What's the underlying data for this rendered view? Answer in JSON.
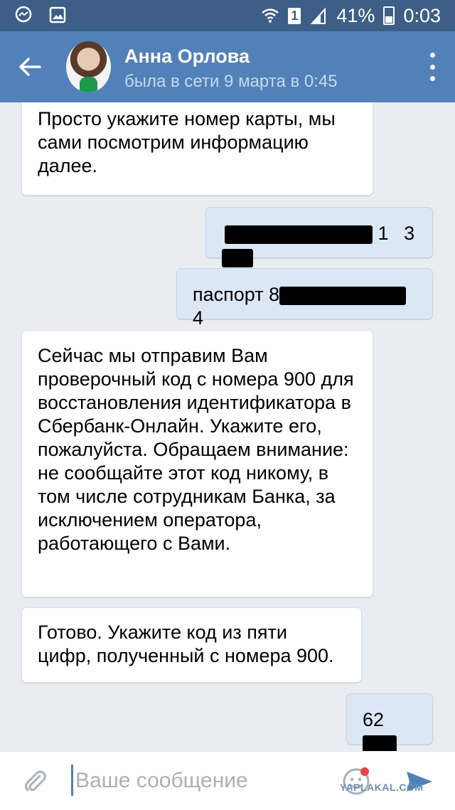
{
  "statusbar": {
    "battery": "41%",
    "time": "0:03",
    "sim": "1"
  },
  "header": {
    "name": "Анна Орлова",
    "status": "была в сети 9 марта в 0:45"
  },
  "messages": [
    {
      "direction": "in",
      "text": "Просто укажите номер карты, мы сами посмотрим информацию далее."
    },
    {
      "direction": "out",
      "prefix": "",
      "visible_parts": [
        "1",
        "3"
      ]
    },
    {
      "direction": "out",
      "prefix": "паспорт 8",
      "suffix": "4"
    },
    {
      "direction": "in",
      "text": "Сейчас мы отправим Вам проверочный код с номера 900 для восстановления идентификатора в Сбербанк-Онлайн. Укажите его, пожалуйста. Обращаем внимание: не сообщайте этот код никому, в том числе сотрудникам Банка, за исключением оператора, работающего с Вами."
    },
    {
      "direction": "in",
      "text": "Готово. Укажите код из пяти цифр, полученный с номера 900."
    },
    {
      "direction": "out",
      "prefix": "62"
    }
  ],
  "input": {
    "placeholder": "Ваше сообщение"
  },
  "watermark": "YAPLAKAL.COM",
  "colors": {
    "statusbar": "#3d5f87",
    "header": "#5181b8",
    "background": "#e9edf1",
    "outgoing_bubble": "#dce7f5",
    "incoming_bubble": "#ffffff"
  }
}
